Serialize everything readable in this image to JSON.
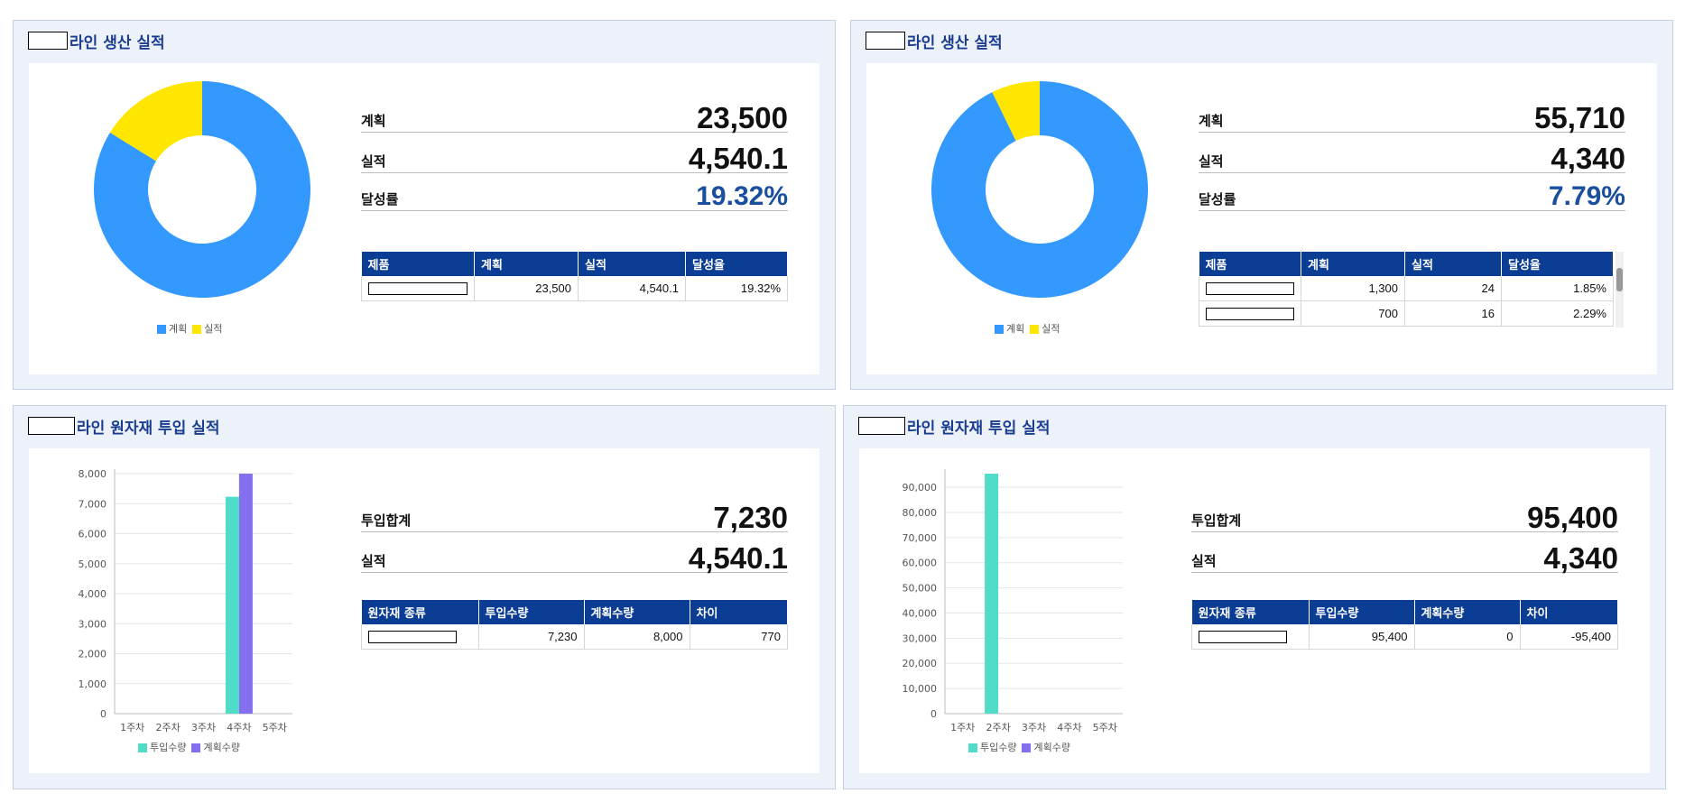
{
  "panels": [
    {
      "title": "라인 생산 실적",
      "kpis": [
        {
          "label": "계획",
          "value": "23,500"
        },
        {
          "label": "실적",
          "value": "4,540.1"
        },
        {
          "label": "달성률",
          "value": "19.32%"
        }
      ],
      "table": {
        "headers": [
          "제품",
          "계획",
          "실적",
          "달성율"
        ],
        "rows": [
          [
            "",
            "23,500",
            "4,540.1",
            "19.32%"
          ]
        ]
      },
      "legend": [
        "계획",
        "실적"
      ]
    },
    {
      "title": "라인 생산 실적",
      "kpis": [
        {
          "label": "계획",
          "value": "55,710"
        },
        {
          "label": "실적",
          "value": "4,340"
        },
        {
          "label": "달성률",
          "value": "7.79%"
        }
      ],
      "table": {
        "headers": [
          "제품",
          "계획",
          "실적",
          "달성율"
        ],
        "rows": [
          [
            "",
            "1,300",
            "24",
            "1.85%"
          ],
          [
            "",
            "700",
            "16",
            "2.29%"
          ]
        ]
      },
      "legend": [
        "계획",
        "실적"
      ]
    },
    {
      "title": "라인 원자재 투입 실적",
      "kpis": [
        {
          "label": "투입합계",
          "value": "7,230"
        },
        {
          "label": "실적",
          "value": "4,540.1"
        }
      ],
      "table": {
        "headers": [
          "원자재 종류",
          "투입수량",
          "계획수량",
          "차이"
        ],
        "rows": [
          [
            "",
            "7,230",
            "8,000",
            "770"
          ]
        ]
      },
      "legend": [
        "투입수량",
        "계획수량"
      ]
    },
    {
      "title": "라인 원자재 투입 실적",
      "kpis": [
        {
          "label": "투입합계",
          "value": "95,400"
        },
        {
          "label": "실적",
          "value": "4,340"
        }
      ],
      "table": {
        "headers": [
          "원자재 종류",
          "투입수량",
          "계획수량",
          "차이"
        ],
        "rows": [
          [
            "",
            "95,400",
            "0",
            "-95,400"
          ]
        ]
      },
      "legend": [
        "투입수량",
        "계획수량"
      ]
    }
  ],
  "colors": {
    "plan": "#3399ff",
    "actual": "#ffe600",
    "input": "#4fdcc9",
    "planned_qty": "#8470ee",
    "header": "#0b3d94",
    "title": "#1a3d8f"
  },
  "chart_data": [
    {
      "type": "pie",
      "donut": true,
      "labels": [
        "계획",
        "실적"
      ],
      "values": [
        23500,
        4540.1
      ],
      "legend": "bottom"
    },
    {
      "type": "pie",
      "donut": true,
      "labels": [
        "계획",
        "실적"
      ],
      "values": [
        55710,
        4340
      ],
      "legend": "bottom"
    },
    {
      "type": "bar",
      "categories": [
        "1주차",
        "2주차",
        "3주차",
        "4주차",
        "5주차"
      ],
      "series": [
        {
          "name": "투입수량",
          "values": [
            0,
            0,
            0,
            7230,
            0
          ]
        },
        {
          "name": "계획수량",
          "values": [
            0,
            0,
            0,
            8000,
            0
          ]
        }
      ],
      "ylim": [
        0,
        8000
      ],
      "yticks": [
        "0",
        "1,000",
        "2,000",
        "3,000",
        "4,000",
        "5,000",
        "6,000",
        "7,000",
        "8,000"
      ],
      "grid": true,
      "legend": "bottom"
    },
    {
      "type": "bar",
      "categories": [
        "1주차",
        "2주차",
        "3주차",
        "4주차",
        "5주차"
      ],
      "series": [
        {
          "name": "투입수량",
          "values": [
            0,
            95400,
            0,
            0,
            0
          ]
        },
        {
          "name": "계획수량",
          "values": [
            0,
            0,
            0,
            0,
            0
          ]
        }
      ],
      "ylim": [
        0,
        95400
      ],
      "yticks": [
        "0",
        "10,000",
        "20,000",
        "30,000",
        "40,000",
        "50,000",
        "60,000",
        "70,000",
        "80,000",
        "90,000"
      ],
      "grid": true,
      "legend": "bottom"
    }
  ]
}
